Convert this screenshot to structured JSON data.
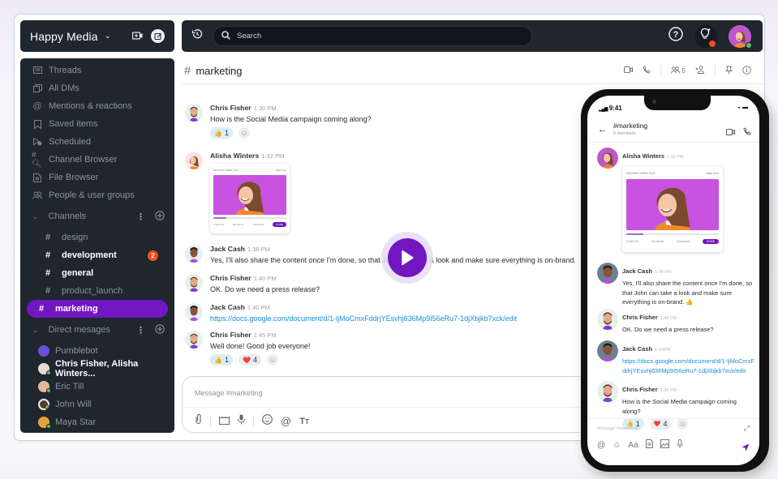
{
  "workspace": {
    "name": "Happy Media"
  },
  "sidebar": {
    "nav": [
      {
        "label": "Threads",
        "icon": "threads-icon"
      },
      {
        "label": "All DMs",
        "icon": "all-dms-icon"
      },
      {
        "label": "Mentions & reactions",
        "icon": "at-icon"
      },
      {
        "label": "Saved items",
        "icon": "bookmark-icon"
      },
      {
        "label": "Scheduled",
        "icon": "scheduled-icon"
      },
      {
        "label": "Channel Browser",
        "icon": "channel-browser-icon"
      },
      {
        "label": "File Browser",
        "icon": "file-browser-icon"
      },
      {
        "label": "People & user groups",
        "icon": "people-icon"
      }
    ],
    "channels_label": "Channels",
    "channels": [
      {
        "name": "design",
        "bold": false,
        "active": false
      },
      {
        "name": "development",
        "bold": true,
        "active": false,
        "badge": "2"
      },
      {
        "name": "general",
        "bold": true,
        "active": false
      },
      {
        "name": "product_launch",
        "bold": false,
        "active": false
      },
      {
        "name": "marketing",
        "bold": true,
        "active": true
      }
    ],
    "dms_label": "Direct mesages",
    "dms": [
      {
        "name": "Pumblebot",
        "bold": false,
        "online": false
      },
      {
        "name": "Chris Fisher, Alisha Winters...",
        "bold": true,
        "online": true
      },
      {
        "name": "Eric Till",
        "bold": false,
        "online": true
      },
      {
        "name": "John Will",
        "bold": false,
        "online": true
      },
      {
        "name": "Maya Star",
        "bold": false,
        "online": true
      }
    ]
  },
  "topbar": {
    "search_placeholder": "Search"
  },
  "channel": {
    "hash": "#",
    "name": "marketing",
    "members_count": "5"
  },
  "messages": [
    {
      "author": "Chris Fisher",
      "time": "1:30 PM",
      "text": "How is the Social Media campaign coming along?",
      "reactions": [
        {
          "emoji": "👍",
          "count": "1",
          "style": "blue"
        }
      ]
    },
    {
      "author": "Alisha Winters",
      "time": "1:32 PM",
      "attachment": {
        "title": "RECORD VIDEO CLIP",
        "start_over": "Start over",
        "duration": "0:45/1:09",
        "set_thumb": "Set thumb",
        "download": "Download",
        "done": "DONE",
        "progress": 0.18
      }
    },
    {
      "author": "Jack Cash",
      "time": "1:38 PM",
      "text": "Yes, I'll also share the content once I'm done, so that John can take a look and make sure everything is on-brand."
    },
    {
      "author": "Chris Fisher",
      "time": "1:40 PM",
      "text": "OK. Do we need a press release?"
    },
    {
      "author": "Jack Cash",
      "time": "1:40 PM",
      "link": "https://docs.google.com/document/d/1-ljMoCmxFddrjYEsvhj636Mp9I56eRu7-1djXbjkb7xck/edit"
    },
    {
      "author": "Chris Fisher",
      "time": "1:45 PM",
      "text": "Well done! Good job everyone!",
      "reactions": [
        {
          "emoji": "👍",
          "count": "1",
          "style": "blue"
        },
        {
          "emoji": "❤️",
          "count": "4",
          "style": "grey"
        }
      ]
    }
  ],
  "composer": {
    "placeholder": "Message #marketing"
  },
  "phone": {
    "time": "9:41",
    "channel": "#marketing",
    "members": "5 members",
    "messages": [
      {
        "author": "Alisha Winters",
        "time": "1:32 PM"
      },
      {
        "author": "Jack Cash",
        "time": "1:38 PM",
        "text": "Yes, I'll also share the content once I'm done, so that John can take a look and make sure everything is on-brand. 👍"
      },
      {
        "author": "Chris Fisher",
        "time": "1:40 PM",
        "text": "OK. Do we need a press release?"
      },
      {
        "author": "Jack Cash",
        "time": "1:40PM",
        "link": "https://docs.google.com/document/d/1-ljMoCmxFddrjYEsvhj636Mp9I56eRu7-1djXbjkb7xck/edit"
      },
      {
        "author": "Chris Fisher",
        "time": "1:30 PM",
        "text": "How is the Social Media campaign coming along?",
        "reactions": [
          {
            "emoji": "👍",
            "count": "1"
          },
          {
            "emoji": "❤️",
            "count": "4"
          }
        ]
      }
    ],
    "composer_placeholder": "Message #marketing"
  },
  "colors": {
    "accent": "#7216c1",
    "sidebar_bg": "#1f262d",
    "badge": "#f24e1e",
    "online": "#56c156",
    "link": "#1a8cd8"
  }
}
